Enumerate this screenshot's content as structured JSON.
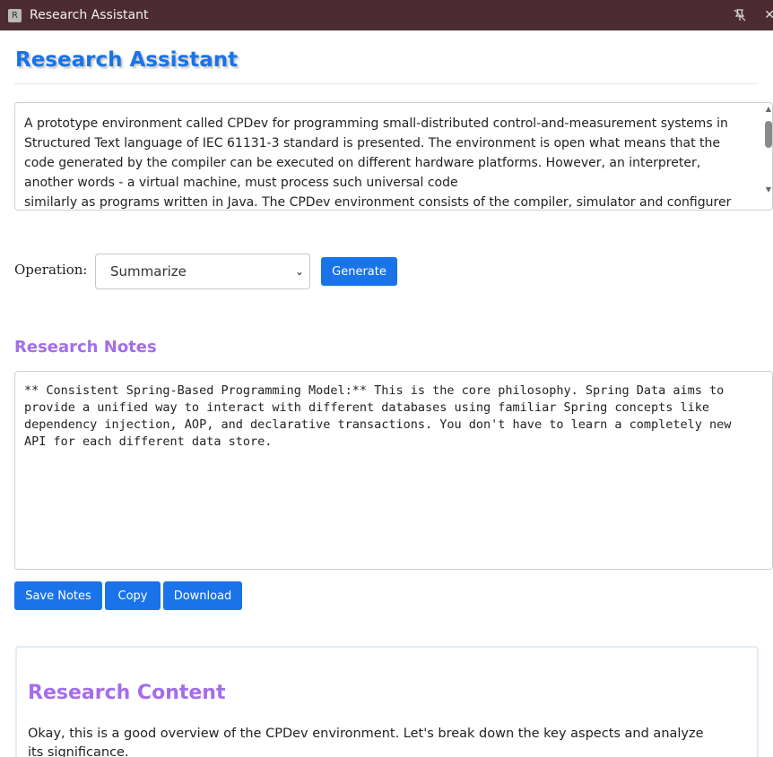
{
  "window": {
    "title": "Research Assistant",
    "icon_letter": "R",
    "titlebar_color": "#4d2b33"
  },
  "header": {
    "title": "Research Assistant"
  },
  "input": {
    "text": "A prototype environment called CPDev for programming small-distributed control-and-measurement systems in Structured Text language of IEC 61131-3 standard is presented. The environment is open what means that the code generated by the compiler can be executed on different hardware platforms. However, an interpreter, another words - a virtual machine, must process such universal code\nsimilarly as programs written in Java. The CPDev environment consists of the compiler, simulator and configurer"
  },
  "operation": {
    "label": "Operation:",
    "selected": "Summarize",
    "generate_label": "Generate"
  },
  "notes": {
    "heading": "Research Notes",
    "text": "** Consistent Spring-Based Programming Model:** This is the core philosophy. Spring Data aims to provide a unified way to interact with different databases using familiar Spring concepts like dependency injection, AOP, and declarative transactions. You don't have to learn a completely new API for each different data store.",
    "buttons": {
      "save": "Save Notes",
      "copy": "Copy",
      "download": "Download"
    }
  },
  "content": {
    "heading": "Research Content",
    "text": "Okay, this is a good overview of the CPDev environment. Let's break down the key aspects and analyze its significance."
  },
  "colors": {
    "primary": "#1a73e8",
    "accent_purple": "#a46ee8"
  }
}
